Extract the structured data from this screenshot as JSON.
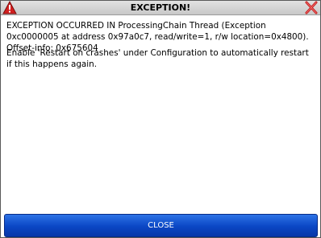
{
  "dialog": {
    "title": "EXCEPTION!",
    "icons": {
      "left": "warning-icon",
      "right": "close-icon"
    },
    "messages": [
      "EXCEPTION OCCURRED IN ProcessingChain Thread (Exception 0xc0000005 at address 0x97a0c7, read/write=1, r/w location=0x4800). Offset-info: 0x675604",
      "Enable 'Restart on crashes' under Configuration to automatically restart if this happens again."
    ],
    "close_button_label": "CLOSE"
  },
  "colors": {
    "button": "#0a46c4",
    "warning_icon": "#d21f1f",
    "close_icon": "#c42020"
  }
}
